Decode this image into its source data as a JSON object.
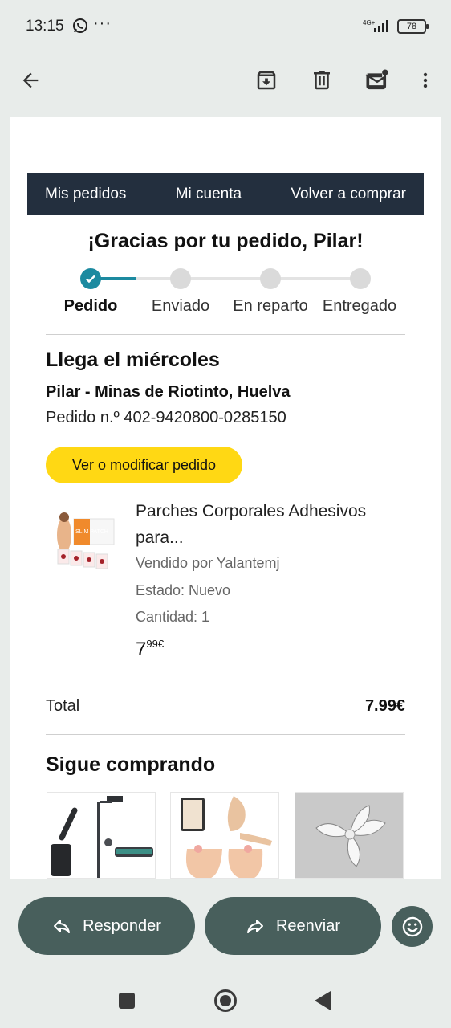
{
  "status_bar": {
    "time": "13:15",
    "more": "···",
    "network": "4G+",
    "battery": "78"
  },
  "toolbar": {
    "back_icon": "arrow-left-icon",
    "archive_icon": "archive-icon",
    "delete_icon": "trash-icon",
    "unread_icon": "mail-unread-icon",
    "more_icon": "more-vert-icon"
  },
  "email": {
    "nav": [
      "Mis pedidos",
      "Mi cuenta",
      "Volver a comprar"
    ],
    "thanks": "¡Gracias por tu pedido, Pilar!",
    "steps": [
      "Pedido",
      "Enviado",
      "En reparto",
      "Entregado"
    ],
    "current_step": 0,
    "progress_fraction": 0.17,
    "arrival": "Llega el miércoles",
    "address": "Pilar - Minas de Riotinto, Huelva",
    "order_number": "Pedido n.º 402-9420800-0285150",
    "modify_button": "Ver o modificar pedido",
    "product": {
      "title": "Parches Corporales Adhesivos para...",
      "seller": "Vendido por Yalantemj",
      "condition": "Estado: Nuevo",
      "quantity": "Cantidad: 1",
      "price_whole": "7",
      "price_fraction": "99€",
      "image_text": "SLIM PATCH"
    },
    "total_label": "Total",
    "total_value": "7.99€",
    "keep_shopping": "Sigue comprando"
  },
  "actions": {
    "reply": "Responder",
    "forward": "Reenviar"
  },
  "colors": {
    "nav_bar": "#232f3e",
    "progress": "#1c8aa0",
    "modify_button": "#ffd814",
    "action_button": "#485f5c"
  }
}
